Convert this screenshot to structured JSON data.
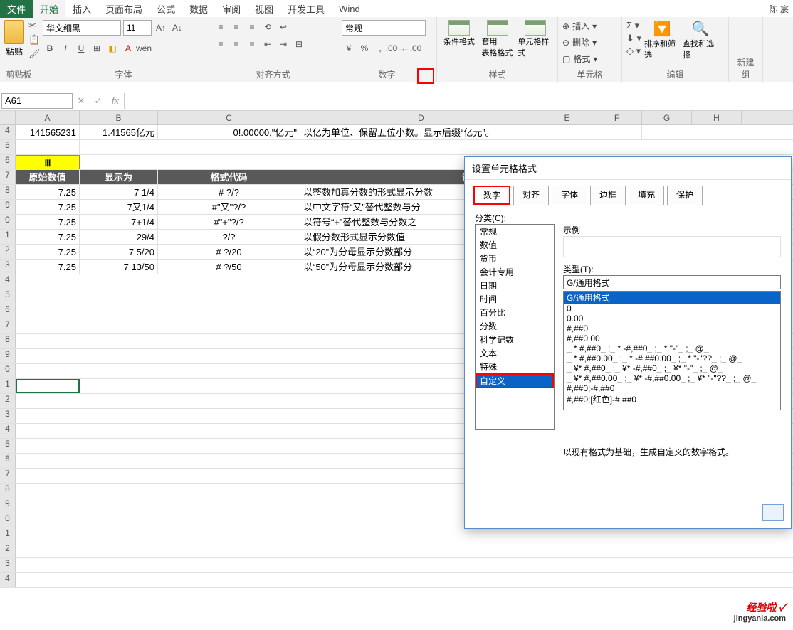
{
  "window": {
    "user": "陈 宸"
  },
  "tabs": {
    "file": "文件",
    "items": [
      "开始",
      "插入",
      "页面布局",
      "公式",
      "数据",
      "审阅",
      "视图",
      "开发工具",
      "Wind"
    ],
    "active": "开始"
  },
  "ribbon": {
    "clipboard": {
      "paste": "粘贴",
      "label": "剪贴板"
    },
    "font": {
      "name": "华文细黑",
      "size": "11",
      "label": "字体",
      "bold": "B",
      "italic": "I",
      "underline": "U"
    },
    "align": {
      "label": "对齐方式"
    },
    "number": {
      "format": "常规",
      "label": "数字"
    },
    "styles": {
      "cond": "条件格式",
      "tbl": "套用\n表格格式",
      "cell": "单元格样式",
      "label": "样式"
    },
    "cells": {
      "insert": "插入",
      "delete": "删除",
      "format": "格式",
      "label": "单元格"
    },
    "editing": {
      "sort": "排序和筛选",
      "find": "查找和选择",
      "label": "编辑"
    },
    "newgroup": "新建组"
  },
  "formula_bar": {
    "name_box": "A61",
    "fx": ""
  },
  "columns": [
    "A",
    "B",
    "C",
    "D",
    "E",
    "F",
    "G",
    "H"
  ],
  "rownums": [
    "4",
    "5",
    "6",
    "7",
    "8",
    "9",
    "0",
    "1",
    "2",
    "3",
    "4",
    "5",
    "6",
    "7",
    "8",
    "9",
    "0",
    "1",
    "2",
    "3",
    "4",
    "5",
    "6",
    "7",
    "8",
    "9",
    "0",
    "1",
    "2",
    "3",
    "4"
  ],
  "data": {
    "r4": {
      "A": "141565231",
      "B": "1.41565亿元",
      "C": "0!.00000,\"亿元\"",
      "D": "以亿为单位、保留五位小数。显示后缀“亿元”。"
    },
    "r6": {
      "A": "Ⅲ"
    },
    "r7": {
      "A": "原始数值",
      "B": "显示为",
      "C": "格式代码",
      "D": "说明"
    },
    "r8": {
      "A": "7.25",
      "B": "7 1/4",
      "C": "# ?/?",
      "D": "以整数加真分数的形式显示分数"
    },
    "r9": {
      "A": "7.25",
      "B": "7又1/4",
      "C": "#\"又\"?/?",
      "D": "以中文字符“又”替代整数与分"
    },
    "r10": {
      "A": "7.25",
      "B": "7+1/4",
      "C": "#\"+\"?/?",
      "D": "以符号“+”替代整数与分数之"
    },
    "r11": {
      "A": "7.25",
      "B": "29/4",
      "C": "?/?",
      "D": "以假分数形式显示分数值"
    },
    "r12": {
      "A": "7.25",
      "B": "7 5/20",
      "C": "# ?/20",
      "D": "以“20”为分母显示分数部分"
    },
    "r13": {
      "A": "7.25",
      "B": "7 13/50",
      "C": "# ?/50",
      "D": "以“50”为分母显示分数部分"
    }
  },
  "dialog": {
    "title": "设置单元格格式",
    "tabs": [
      "数字",
      "对齐",
      "字体",
      "边框",
      "填充",
      "保护"
    ],
    "active_tab": "数字",
    "category_label": "分类(C):",
    "categories": [
      "常规",
      "数值",
      "货币",
      "会计专用",
      "日期",
      "时间",
      "百分比",
      "分数",
      "科学记数",
      "文本",
      "特殊",
      "自定义"
    ],
    "selected_category": "自定义",
    "sample_label": "示例",
    "type_label": "类型(T):",
    "type_value": "G/通用格式",
    "type_list": [
      "G/通用格式",
      "0",
      "0.00",
      "#,##0",
      "#,##0.00",
      "_ * #,##0_ ;_ * -#,##0_ ;_ * \"-\"_ ;_ @_",
      "_ * #,##0.00_ ;_ * -#,##0.00_ ;_ * \"-\"??_ ;_ @_",
      "_ ¥* #,##0_ ;_ ¥* -#,##0_ ;_ ¥* \"-\"_ ;_ @_",
      "_ ¥* #,##0.00_ ;_ ¥* -#,##0.00_ ;_ ¥* \"-\"??_ ;_ @_",
      "#,##0;-#,##0",
      "#,##0;[红色]-#,##0"
    ],
    "note": "以现有格式为基础，生成自定义的数字格式。"
  },
  "watermark": {
    "brand": "经验啦 ✓",
    "domain": "jingyanla.com"
  }
}
